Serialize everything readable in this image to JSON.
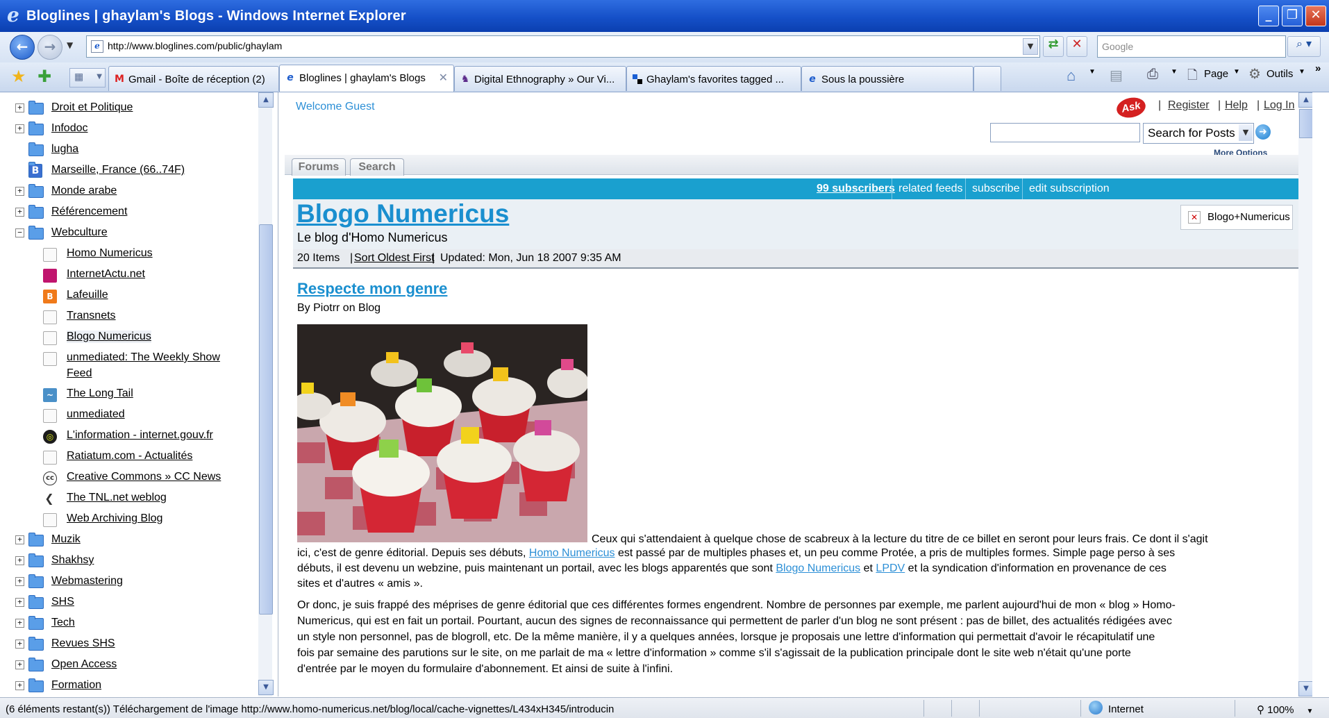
{
  "window": {
    "title": "Bloglines | ghaylam's Blogs - Windows Internet Explorer"
  },
  "address": {
    "url": "http://www.bloglines.com/public/ghaylam",
    "search_placeholder": "Google"
  },
  "tabs": [
    {
      "label": "Gmail - Boîte de réception (2)",
      "icon": "gmail-icon"
    },
    {
      "label": "Bloglines | ghaylam's Blogs",
      "icon": "ie-page-icon",
      "active": true
    },
    {
      "label": "Digital Ethnography » Our Vi...",
      "icon": "ksu-icon"
    },
    {
      "label": "Ghaylam's favorites tagged ...",
      "icon": "delicious-icon"
    },
    {
      "label": "Sous la poussière",
      "icon": "ie-page-icon"
    }
  ],
  "commandbar": {
    "page_label": "Page",
    "tools_label": "Outils"
  },
  "sidebar": {
    "folders_top": [
      {
        "label": "Droit et Politique",
        "expandable": true
      },
      {
        "label": "Infodoc",
        "expandable": true
      },
      {
        "label": "lugha",
        "expandable": false
      },
      {
        "label": "Marseille, France (66..74F)",
        "expandable": false,
        "blogger": true
      },
      {
        "label": "Monde arabe",
        "expandable": true
      },
      {
        "label": "Référencement",
        "expandable": true
      },
      {
        "label": "Webculture",
        "expandable": true,
        "expanded": true
      }
    ],
    "feeds": [
      {
        "label": "Homo Numericus"
      },
      {
        "label": "InternetActu.net"
      },
      {
        "label": "Lafeuille"
      },
      {
        "label": "Transnets"
      },
      {
        "label": "Blogo Numericus"
      },
      {
        "label": "unmediated: The Weekly Show",
        "label2": "Feed"
      },
      {
        "label": "The Long Tail"
      },
      {
        "label": "unmediated"
      },
      {
        "label": "L'information - internet.gouv.fr"
      },
      {
        "label": "Ratiatum.com - Actualités"
      },
      {
        "label": "Creative Commons » CC News"
      },
      {
        "label": "The TNL.net weblog"
      },
      {
        "label": "Web Archiving Blog"
      }
    ],
    "folders_bottom": [
      {
        "label": "Muzik"
      },
      {
        "label": "Shakhsy"
      },
      {
        "label": "Webmastering"
      },
      {
        "label": "SHS"
      },
      {
        "label": "Tech"
      },
      {
        "label": "Revues SHS"
      },
      {
        "label": "Open Access"
      },
      {
        "label": "Formation"
      }
    ]
  },
  "header": {
    "welcome": "Welcome Guest",
    "ask_logo": "Ask",
    "register": "Register",
    "help": "Help",
    "login": "Log In",
    "search_select": "Search for Posts",
    "more_options": "More Options",
    "tab_forums": "Forums",
    "tab_search": "Search"
  },
  "feed": {
    "subscribers": "99 subscribers",
    "related_feeds": "related feeds",
    "subscribe": "subscribe",
    "edit_subscription": "edit subscription",
    "title": "Blogo Numericus",
    "subtitle": "Le blog d'Homo Numericus",
    "button_label": "Blogo+Numericus",
    "items_count": "20 Items",
    "sort_label": "Sort Oldest First",
    "updated": "Updated: Mon, Jun 18 2007 9:35 AM"
  },
  "post": {
    "title": "Respecte mon genre",
    "byline": "By Piotrr on Blog",
    "p1": [
      "Ceux qui s'attendaient à quelque chose de scabreux à la lecture du titre de ce billet en seront pour leurs frais. Ce dont il s'agit",
      "ici, c'est de genre éditorial. Depuis ses débuts,",
      "Homo Numericus",
      "est passé par de multiples phases et, un peu comme Protée, a pris de multiples formes. Simple page perso à ses",
      "débuts, il est devenu un webzine, puis maintenant un portail, avec les blogs apparentés que sont",
      "Blogo Numericus",
      "et",
      "LPDV",
      "et la syndication d'information en provenance de ces",
      "sites et d'autres « amis »."
    ],
    "p2": [
      "Or donc, je suis frappé des méprises de genre éditorial que ces différentes formes engendrent. Nombre de personnes par exemple, me parlent aujourd'hui de mon « blog » Homo-",
      "Numericus, qui est en fait un portail. Pourtant, aucun des signes de reconnaissance qui permettent de parler d'un blog ne sont présent : pas de billet, des actualités rédigées avec",
      "un style non personnel, pas de blogroll, etc. De la même manière, il y a quelques années, lorsque je proposais une lettre d'information qui permettait d'avoir le récapitulatif une",
      "fois par semaine des parutions sur le site, on me parlait de ma « lettre d'information » comme s'il s'agissait de la publication principale dont le site web n'était qu'une porte",
      "d'entrée par le moyen du formulaire d'abonnement. Et ainsi de suite à l'infini."
    ]
  },
  "status": {
    "text": "(6 éléments restant(s)) Téléchargement de l'image http://www.homo-numericus.net/blog/local/cache-vignettes/L434xH345/introducin",
    "zone": "Internet",
    "zoom": "100%"
  },
  "colors": {
    "accent": "#1aa0cf",
    "link": "#2c8fd6",
    "titlebar": "#1550c8"
  }
}
